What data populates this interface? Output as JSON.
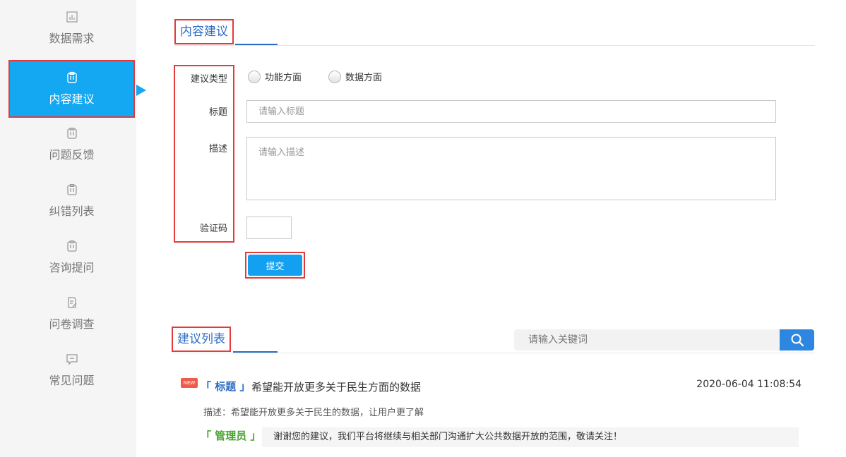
{
  "sidebar": {
    "items": [
      {
        "label": "数据需求",
        "icon": "bar-chart-icon"
      },
      {
        "label": "内容建议",
        "icon": "clipboard-icon"
      },
      {
        "label": "问题反馈",
        "icon": "clipboard-icon"
      },
      {
        "label": "纠错列表",
        "icon": "clipboard-icon"
      },
      {
        "label": "咨询提问",
        "icon": "clipboard-icon"
      },
      {
        "label": "问卷调查",
        "icon": "edit-doc-icon"
      },
      {
        "label": "常见问题",
        "icon": "message-icon"
      }
    ],
    "active_index": 1
  },
  "form_section": {
    "title": "内容建议",
    "type_label": "建议类型",
    "type_options": [
      "功能方面",
      "数据方面"
    ],
    "title_label": "标题",
    "title_placeholder": "请输入标题",
    "desc_label": "描述",
    "desc_placeholder": "请输入描述",
    "captcha_label": "验证码",
    "submit_label": "提交"
  },
  "list_section": {
    "title": "建议列表",
    "search_placeholder": "请输入关键词",
    "items": [
      {
        "badge": "NEW",
        "tag": "「 标题 」",
        "title": "希望能开放更多关于民生方面的数据",
        "time": "2020-06-04 11:08:54",
        "desc": "描述：希望能开放更多关于民生的数据，让用户更了解",
        "admin_tag": "「 管理员 」",
        "reply": "谢谢您的建议，我们平台将继续与相关部门沟通扩大公共数据开放的范围，敬请关注！"
      }
    ]
  },
  "colors": {
    "accent_blue": "#14a7f2",
    "title_blue": "#2b6cc4",
    "highlight_red": "#e23b3b",
    "admin_green": "#4aa332"
  }
}
